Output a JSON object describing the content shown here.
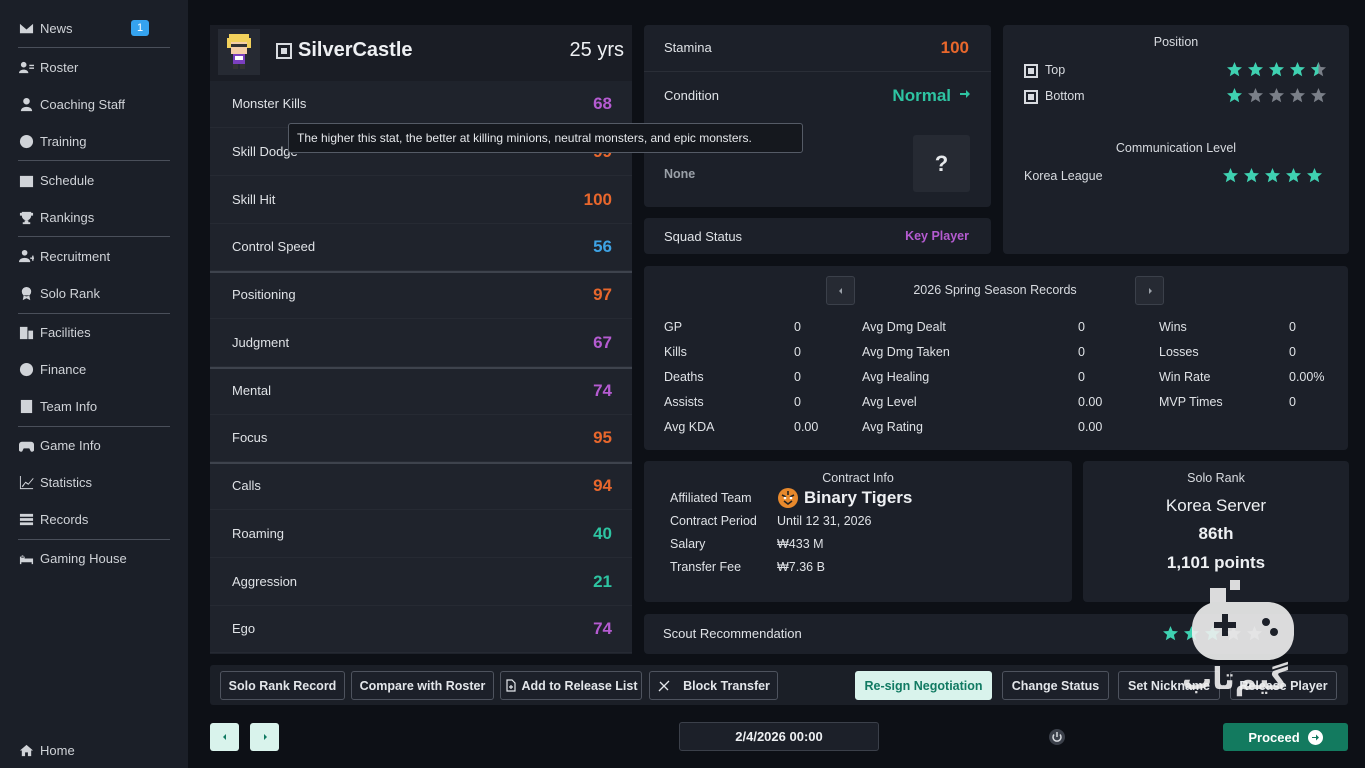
{
  "sidebar": {
    "items": [
      {
        "label": "News",
        "icon": "mail-icon",
        "badge": "1"
      },
      {
        "label": "Roster",
        "icon": "roster-icon"
      },
      {
        "label": "Coaching Staff",
        "icon": "coach-icon"
      },
      {
        "label": "Training",
        "icon": "training-icon"
      },
      {
        "label": "Schedule",
        "icon": "calendar-icon"
      },
      {
        "label": "Rankings",
        "icon": "trophy-icon"
      },
      {
        "label": "Recruitment",
        "icon": "add-user-icon"
      },
      {
        "label": "Solo Rank",
        "icon": "medal-icon"
      },
      {
        "label": "Facilities",
        "icon": "building-icon"
      },
      {
        "label": "Finance",
        "icon": "coin-icon"
      },
      {
        "label": "Team Info",
        "icon": "document-icon"
      },
      {
        "label": "Game Info",
        "icon": "gamepad-icon"
      },
      {
        "label": "Statistics",
        "icon": "chart-line-icon"
      },
      {
        "label": "Records",
        "icon": "list-icon"
      },
      {
        "label": "Gaming House",
        "icon": "bed-icon"
      }
    ],
    "home": "Home"
  },
  "player": {
    "name": "SilverCastle",
    "age": "25 yrs"
  },
  "stats": [
    {
      "label": "Monster Kills",
      "value": "68",
      "color": "#b55bd1"
    },
    {
      "label": "Skill Dodge",
      "value": "99",
      "color": "#e8672c"
    },
    {
      "label": "Skill Hit",
      "value": "100",
      "color": "#e8672c"
    },
    {
      "label": "Control Speed",
      "value": "56",
      "color": "#3ea3e5"
    },
    {
      "label": "Positioning",
      "value": "97",
      "color": "#e8672c"
    },
    {
      "label": "Judgment",
      "value": "67",
      "color": "#b55bd1"
    },
    {
      "label": "Mental",
      "value": "74",
      "color": "#b55bd1"
    },
    {
      "label": "Focus",
      "value": "95",
      "color": "#e8672c"
    },
    {
      "label": "Calls",
      "value": "94",
      "color": "#e8672c"
    },
    {
      "label": "Roaming",
      "value": "40",
      "color": "#2ec4a2"
    },
    {
      "label": "Aggression",
      "value": "21",
      "color": "#2ec4a2"
    },
    {
      "label": "Ego",
      "value": "74",
      "color": "#b55bd1"
    }
  ],
  "tooltip": "The higher this stat, the better at killing minions, neutral monsters, and epic monsters.",
  "status": {
    "stamina_label": "Stamina",
    "stamina_value": "100",
    "condition_label": "Condition",
    "condition_value": "Normal",
    "trait_value": "None",
    "mystery": "?",
    "squad_label": "Squad Status",
    "squad_value": "Key Player"
  },
  "position": {
    "title": "Position",
    "rows": [
      {
        "label": "Top",
        "stars": 4.5
      },
      {
        "label": "Bottom",
        "stars": 1
      }
    ],
    "comm_title": "Communication Level",
    "comm_label": "Korea League",
    "comm_stars": 5
  },
  "season": {
    "title": "2026 Spring Season Records",
    "col1": [
      [
        "GP",
        "0"
      ],
      [
        "Kills",
        "0"
      ],
      [
        "Deaths",
        "0"
      ],
      [
        "Assists",
        "0"
      ],
      [
        "Avg KDA",
        "0.00"
      ]
    ],
    "col2": [
      [
        "Avg Dmg Dealt",
        "0"
      ],
      [
        "Avg Dmg Taken",
        "0"
      ],
      [
        "Avg Healing",
        "0"
      ],
      [
        "Avg Level",
        "0.00"
      ],
      [
        "Avg Rating",
        "0.00"
      ]
    ],
    "col3": [
      [
        "Wins",
        "0"
      ],
      [
        "Losses",
        "0"
      ],
      [
        "Win Rate",
        "0.00%"
      ],
      [
        "MVP Times",
        "0"
      ]
    ]
  },
  "contract": {
    "title": "Contract Info",
    "team_label": "Affiliated Team",
    "team_value": "Binary Tigers",
    "period_label": "Contract Period",
    "period_value": "Until 12 31, 2026",
    "salary_label": "Salary",
    "salary_value": "₩433 M",
    "fee_label": "Transfer Fee",
    "fee_value": "₩7.36 B"
  },
  "solo": {
    "title": "Solo Rank",
    "server": "Korea Server",
    "rank": "86th",
    "points": "1,101 points"
  },
  "scout": {
    "label": "Scout Recommendation",
    "stars": 3
  },
  "buttons": {
    "solo_rank_record": "Solo Rank Record",
    "compare": "Compare with Roster",
    "add_release": "Add to Release List",
    "block_transfer": "Block Transfer",
    "resign": "Re-sign Negotiation",
    "change_status": "Change Status",
    "set_nickname": "Set Nickname",
    "release": "Release Player"
  },
  "footer": {
    "date": "2/4/2026 00:00",
    "proceed": "Proceed"
  },
  "watermark": "گیم‌تاب",
  "colors": {
    "accent": "#2ec4a2",
    "star": "#3fd1b1",
    "star_off": "#7a7f88"
  }
}
